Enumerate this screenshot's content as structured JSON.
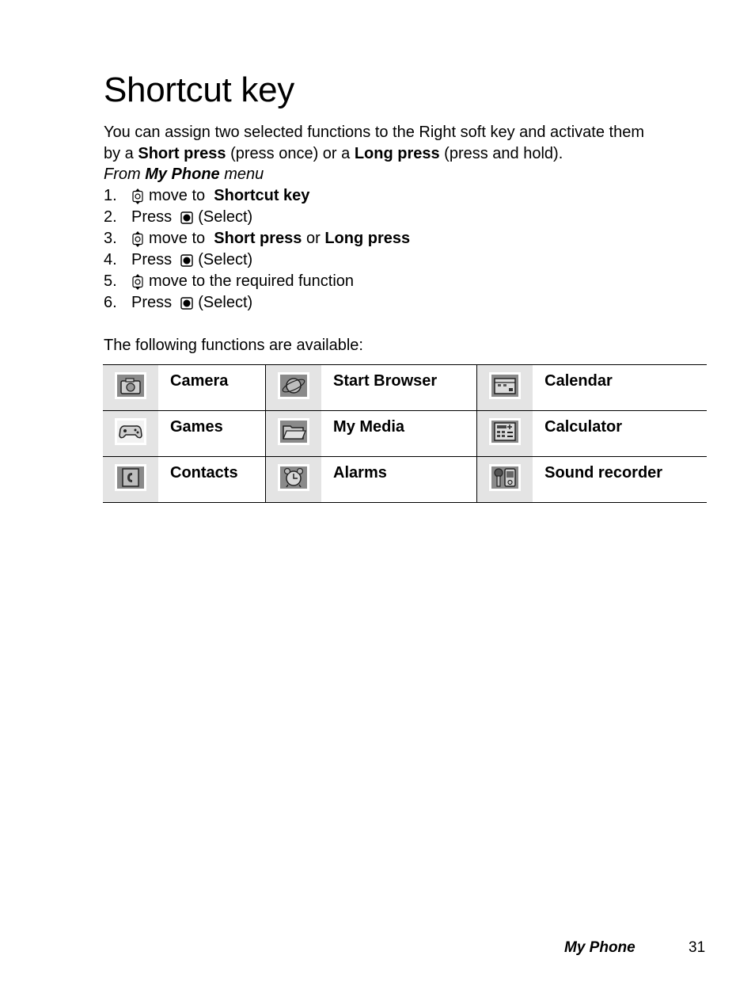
{
  "title": "Shortcut key",
  "intro": {
    "line1": "You can assign two selected functions to the Right soft key and activate them",
    "line2_prefix": "by a ",
    "short_press": "Short press",
    "line2_mid": " (press once) or a ",
    "long_press": "Long press",
    "line2_suffix": " (press and hold).",
    "from_prefix": "From ",
    "from_menu": "My Phone",
    "from_suffix": " menu"
  },
  "steps": [
    {
      "num": "1.",
      "icon": "nav-key-icon",
      "text": "move to ",
      "bold": "Shortcut key"
    },
    {
      "num": "2.",
      "icon": "select-key-icon",
      "prefix": "Press ",
      "text": "(Select)"
    },
    {
      "num": "3.",
      "icon": "nav-key-icon",
      "text": "move to ",
      "bold": "Short press",
      "mid": " or ",
      "bold2": "Long press"
    },
    {
      "num": "4.",
      "icon": "select-key-icon",
      "prefix": "Press ",
      "text": "(Select)"
    },
    {
      "num": "5.",
      "icon": "nav-key-icon",
      "text": "move to the required function"
    },
    {
      "num": "6.",
      "icon": "select-key-icon",
      "prefix": "Press ",
      "text": "(Select)"
    }
  ],
  "available_label": "The following functions are available:",
  "functions": [
    [
      {
        "label": "Camera",
        "icon": "camera-icon"
      },
      {
        "label": "Start Browser",
        "icon": "browser-globe-icon"
      },
      {
        "label": "Calendar",
        "icon": "calendar-icon"
      }
    ],
    [
      {
        "label": "Games",
        "icon": "gamepad-icon"
      },
      {
        "label": "My Media",
        "icon": "folder-icon"
      },
      {
        "label": "Calculator",
        "icon": "calculator-icon"
      }
    ],
    [
      {
        "label": "Contacts",
        "icon": "contacts-phone-icon"
      },
      {
        "label": "Alarms",
        "icon": "alarm-clock-icon"
      },
      {
        "label": "Sound recorder",
        "icon": "microphone-recorder-icon"
      }
    ]
  ],
  "footer": {
    "section": "My Phone",
    "page_number": "31"
  }
}
